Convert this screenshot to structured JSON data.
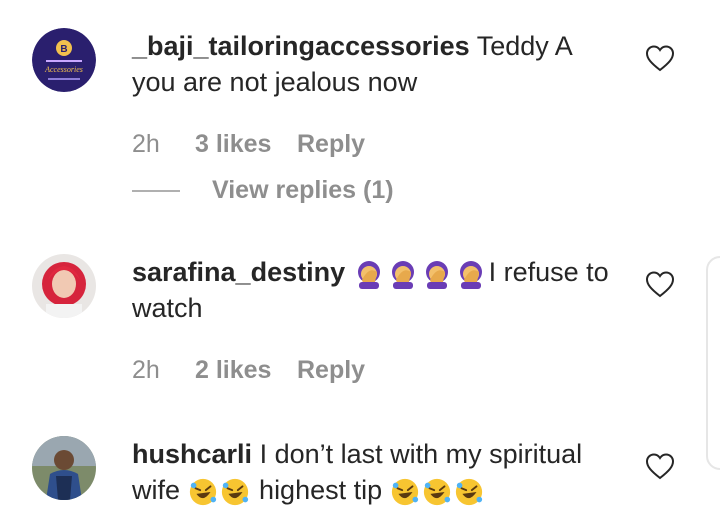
{
  "comments": [
    {
      "username": "_baji_tailoringaccessories",
      "text_part1": "Teddy A",
      "text_part2": "you are not jealous now",
      "time": "2h",
      "likes": "3 likes",
      "reply": "Reply",
      "view_replies": "View replies (1)",
      "avatar_text": "Accessories"
    },
    {
      "username": "sarafina_destiny",
      "emojis": [
        "face-palm",
        "face-palm",
        "face-palm",
        "face-palm"
      ],
      "text_part1": "I refuse to",
      "text_part2": "watch",
      "time": "2h",
      "likes": "2 likes",
      "reply": "Reply"
    },
    {
      "username": "hushcarli",
      "text_part1": "I don’t last with my spiritual",
      "text_part2_a": "wife",
      "text_part2_b": "highest tip",
      "emojis_a": [
        "rolling-laughing",
        "rolling-laughing"
      ],
      "emojis_b": [
        "rolling-laughing",
        "rolling-laughing",
        "rolling-laughing"
      ]
    }
  ],
  "colors": {
    "text": "#262626",
    "muted": "#8e8e8e",
    "avatar1_bg": "#2a1f6e",
    "emoji_yellow": "#f7c531"
  }
}
